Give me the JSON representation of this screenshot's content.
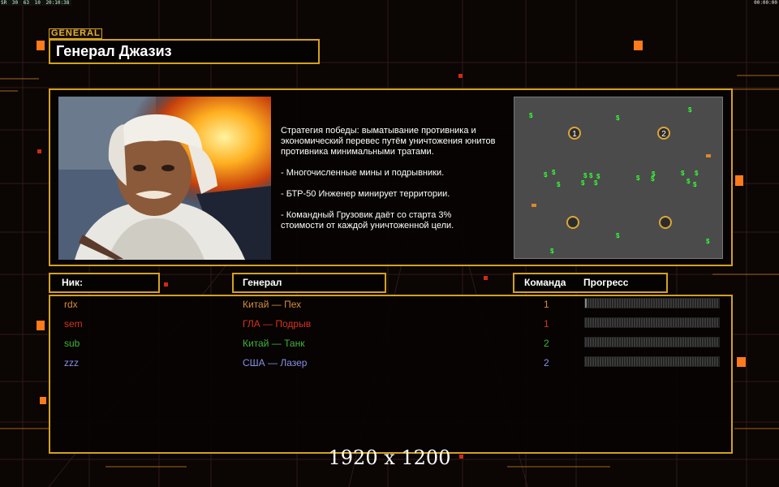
{
  "topbar": {
    "left_items": [
      "SR",
      "30",
      "63",
      "10",
      "20:10:38"
    ],
    "right": "00:00:00"
  },
  "general_tag": "GENERAL",
  "title": "Генерал Джазиз",
  "description": [
    "Стратегия победы: выматывание противника и\n экономический перевес путём уничтожения юнитов\n противника минимальными тратами.",
    "- Многочисленные мины и подрывники.",
    "- БТР-50 Инженер минирует территории.",
    "- Командный Грузовик даёт со старта 3%\n стоимости от каждой уничтоженной цели."
  ],
  "minimap": {
    "start_labels": [
      "1",
      "2"
    ],
    "cash_symbol": "$"
  },
  "columns": {
    "nick": "Ник:",
    "general": "Генерал",
    "team": "Команда",
    "progress": "Прогресс"
  },
  "players": [
    {
      "nick": "rdx",
      "general": "Китай — Пех",
      "team": "1",
      "color": "#d88c3a",
      "progress": 0.01
    },
    {
      "nick": "sem",
      "general": "ГЛА — Подрыв",
      "team": "1",
      "color": "#d9301f",
      "progress": 0
    },
    {
      "nick": "sub",
      "general": "Китай — Танк",
      "team": "2",
      "color": "#3fb43a",
      "progress": 0
    },
    {
      "nick": "zzz",
      "general": "США — Лазер",
      "team": "2",
      "color": "#8a8fe6",
      "progress": 0
    }
  ],
  "resolution_label": "1920 x 1200",
  "colors": {
    "accent": "#d4a21b",
    "background": "#0b0504"
  }
}
